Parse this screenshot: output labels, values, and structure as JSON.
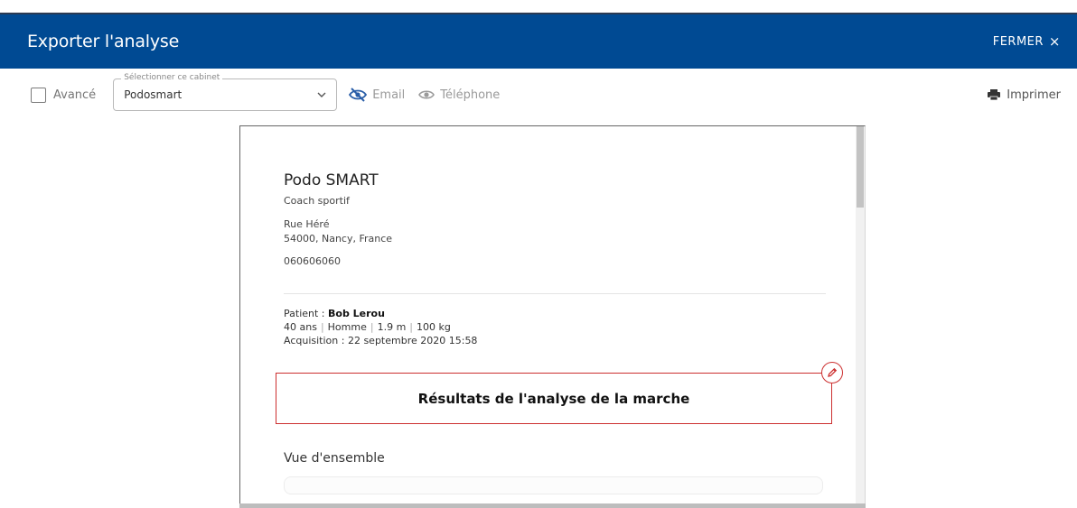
{
  "header": {
    "title": "Exporter l'analyse",
    "close_label": "FERMER",
    "close_icon": "×"
  },
  "toolbar": {
    "advanced_label": "Avancé",
    "cabinet_legend": "Sélectionner ce cabinet",
    "cabinet_value": "Podosmart",
    "email_label": "Email",
    "phone_label": "Téléphone",
    "print_label": "Imprimer"
  },
  "document": {
    "company_name": "Podo SMART",
    "company_subtitle": "Coach sportif",
    "street": "Rue Héré",
    "city": "54000, Nancy, France",
    "phone": "060606060",
    "patient_prefix": "Patient : ",
    "patient_name": "Bob Lerou",
    "age": "40 ans",
    "sex": "Homme",
    "height": "1.9 m",
    "weight": "100 kg",
    "acquisition": "Acquisition : 22 septembre 2020 15:58",
    "results_title": "Résultats de l'analyse de la marche",
    "section_title": "Vue d'ensemble"
  },
  "colors": {
    "header_bg": "#004a93",
    "accent_red": "#cc2f2f"
  }
}
